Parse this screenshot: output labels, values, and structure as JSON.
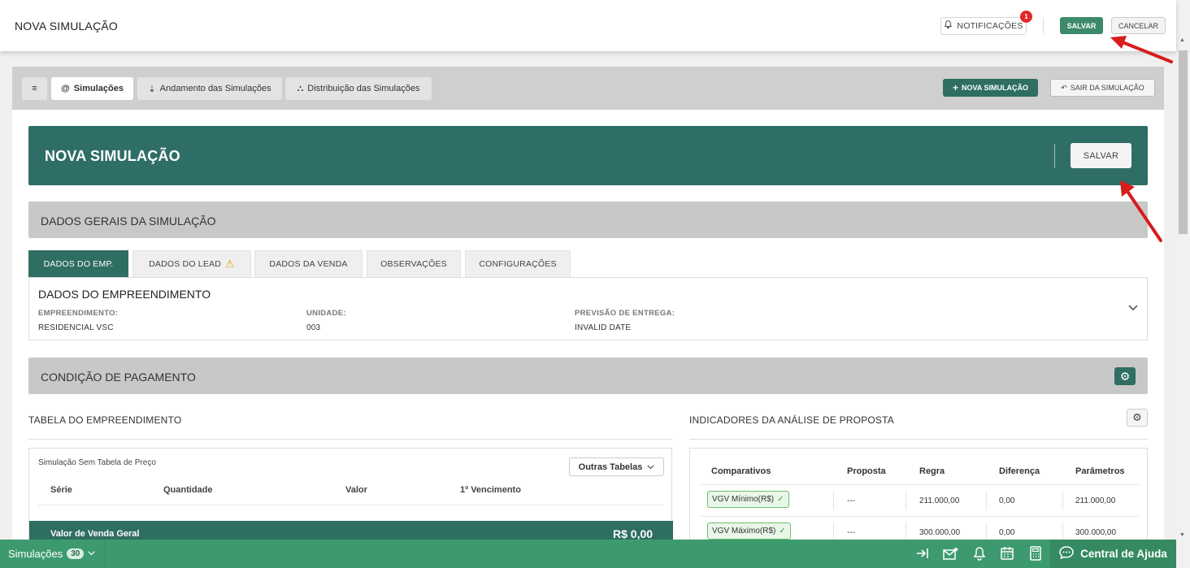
{
  "header": {
    "title": "NOVA SIMULAÇÃO",
    "notifications_label": "NOTIFICAÇÕES",
    "notifications_count": "1",
    "save_label": "SALVAR",
    "cancel_label": "CANCELAR"
  },
  "tabs_bar": {
    "menu_glyph": "≡",
    "tabs": [
      {
        "icon": "@",
        "label": "Simulações"
      },
      {
        "icon": "⇣",
        "label": "Andamento das Simulações"
      },
      {
        "icon": "⛬",
        "label": "Distribuição das Simulações"
      }
    ],
    "new_simulation_label": "NOVA SIMULAÇÃO",
    "exit_simulation_label": "SAIR DA SIMULAÇÃO"
  },
  "hero": {
    "title": "NOVA SIMULAÇÃO",
    "save_label": "SALVAR"
  },
  "dados_gerais": {
    "title": "DADOS GERAIS DA SIMULAÇÃO",
    "tabs": [
      "DADOS DO EMP.",
      "DADOS DO LEAD",
      "DADOS DA VENDA",
      "OBSERVAÇÕES",
      "CONFIGURAÇÕES"
    ]
  },
  "empreendimento": {
    "title": "DADOS DO EMPREENDIMENTO",
    "fields": [
      {
        "label": "EMPREENDIMENTO:",
        "value": "RESIDENCIAL VSC"
      },
      {
        "label": "UNIDADE:",
        "value": "003"
      },
      {
        "label": "PREVISÃO DE ENTREGA:",
        "value": "INVALID DATE"
      }
    ]
  },
  "condicao": {
    "title": "CONDIÇÃO DE PAGAMENTO"
  },
  "tabela": {
    "title": "TABELA DO EMPREENDIMENTO",
    "note": "Simulação Sem Tabela de Preço",
    "outras_label": "Outras Tabelas",
    "columns": [
      "Série",
      "Quantidade",
      "Valor",
      "1º Vencimento"
    ],
    "total_label": "Valor de Venda Geral",
    "total_value": "R$ 0,00"
  },
  "indicadores": {
    "title": "INDICADORES DA ANÁLISE DE PROPOSTA",
    "columns": [
      "Comparativos",
      "Proposta",
      "Regra",
      "Diferença",
      "Parâmetros"
    ],
    "rows": [
      {
        "comparativo": "VGV Mínimo(R$)",
        "proposta": "---",
        "regra": "211.000,00",
        "diferenca": "0,00",
        "parametros": "211.000,00"
      },
      {
        "comparativo": "VGV Máximo(R$)",
        "proposta": "---",
        "regra": "300.000,00",
        "diferenca": "0,00",
        "parametros": "300.000,00"
      }
    ]
  },
  "bottom": {
    "simulacoes_label": "Simulações",
    "simulacoes_count": "30",
    "help_label": "Central de Ajuda"
  },
  "colors": {
    "primary_dark": "#2f6e62",
    "primary": "#3d8a6a",
    "bottom_bar": "#3d9a6e",
    "danger": "#e02828",
    "annotation_arrow": "#d81c1c"
  }
}
